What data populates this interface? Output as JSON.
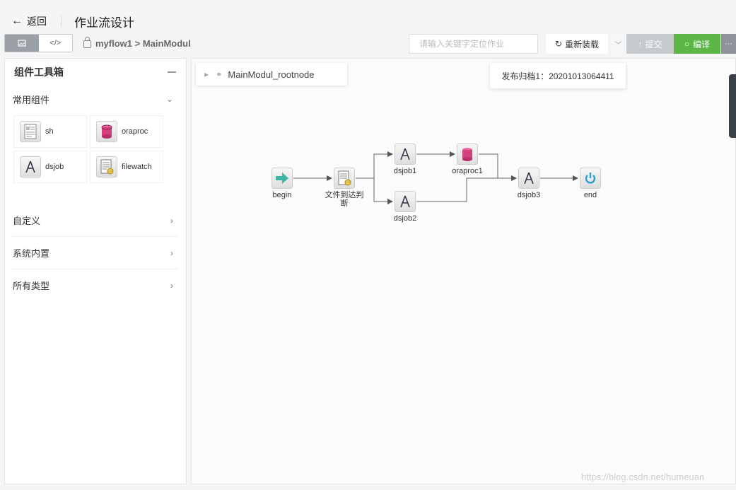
{
  "header": {
    "back_label": "返回",
    "title": "作业流设计"
  },
  "toolbar": {
    "breadcrumb": "myflow1 > MainModul",
    "search_placeholder": "请输入关键字定位作业",
    "reload_label": "重新装载",
    "submit_label": "提交",
    "compile_label": "编译",
    "more_label": "···"
  },
  "sidebar": {
    "title": "组件工具箱",
    "open_category": "常用组件",
    "components": [
      {
        "label": "sh",
        "icon": "document-icon"
      },
      {
        "label": "oraproc",
        "icon": "database-icon"
      },
      {
        "label": "dsjob",
        "icon": "compass-icon"
      },
      {
        "label": "filewatch",
        "icon": "file-watch-icon"
      }
    ],
    "categories": [
      "自定义",
      "系统内置",
      "所有类型"
    ]
  },
  "canvas": {
    "root_node": "MainModul_rootnode",
    "archive_label": "发布归档1：20201013064411",
    "watermark": "https://blog.csdn.net/humeuan"
  },
  "flow": {
    "nodes": [
      {
        "id": "begin",
        "label": "begin",
        "icon": "arrow-right-icon"
      },
      {
        "id": "filecheck",
        "label": "文件到达判\n断",
        "icon": "file-watch-icon"
      },
      {
        "id": "dsjob1",
        "label": "dsjob1",
        "icon": "compass-icon"
      },
      {
        "id": "dsjob2",
        "label": "dsjob2",
        "icon": "compass-icon"
      },
      {
        "id": "oraproc1",
        "label": "oraproc1",
        "icon": "database-icon"
      },
      {
        "id": "dsjob3",
        "label": "dsjob3",
        "icon": "compass-icon"
      },
      {
        "id": "end",
        "label": "end",
        "icon": "power-icon"
      }
    ],
    "edges": [
      [
        "begin",
        "filecheck"
      ],
      [
        "filecheck",
        "dsjob1"
      ],
      [
        "filecheck",
        "dsjob2"
      ],
      [
        "dsjob1",
        "oraproc1"
      ],
      [
        "oraproc1",
        "dsjob3"
      ],
      [
        "dsjob2",
        "dsjob3"
      ],
      [
        "dsjob3",
        "end"
      ]
    ]
  }
}
